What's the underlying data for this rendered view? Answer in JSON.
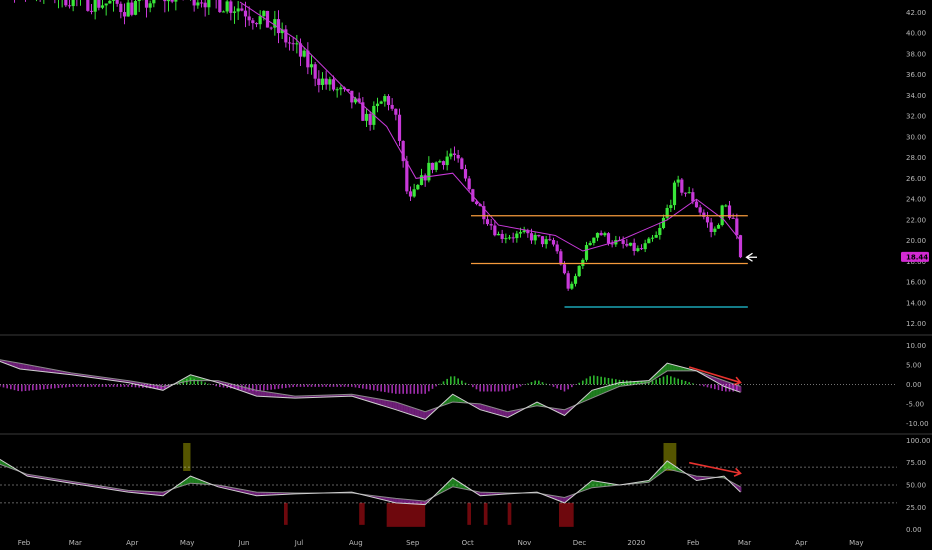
{
  "colors": {
    "bull": "#39e639",
    "bear": "#c839d9",
    "ma": "#c839d9",
    "channel": "#f59a3c",
    "support": "#21c7d9",
    "arrow_white": "#ffffff",
    "arrow_red": "#e8322e",
    "price_tag": "#d22ad2",
    "axis_text": "#b9b9b9",
    "separator": "#3a3a3a"
  },
  "chart_data": [
    {
      "type": "candlestick",
      "name": "price",
      "x_labels": [
        "Feb",
        "Mar",
        "Apr",
        "May",
        "Jun",
        "Jul",
        "Aug",
        "Sep",
        "Oct",
        "Nov",
        "Dec",
        "2020",
        "Feb",
        "Mar",
        "Apr",
        "May"
      ],
      "ylim": [
        11.0,
        43.2
      ],
      "yticks": [
        "12.00",
        "14.00",
        "16.00",
        "18.00",
        "20.00",
        "22.00",
        "24.00",
        "26.00",
        "28.00",
        "30.00",
        "32.00",
        "34.00",
        "36.00",
        "38.00",
        "40.00",
        "42.00"
      ],
      "last_price": "18.44",
      "close_path": [
        [
          "Jan 01",
          45.0
        ],
        [
          "Feb 01",
          44.5
        ],
        [
          "Mar 01",
          43.5
        ],
        [
          "Apr 01",
          42.5
        ],
        [
          "May 01",
          44.0
        ],
        [
          "Jun 01",
          42.5
        ],
        [
          "Jun 20",
          40.5
        ],
        [
          "Jul 01",
          38.5
        ],
        [
          "Jul 15",
          35.5
        ],
        [
          "Aug 01",
          33.5
        ],
        [
          "Aug 10",
          31.5
        ],
        [
          "Aug 20",
          34.0
        ],
        [
          "Aug 26",
          31.0
        ],
        [
          "Sep 01",
          23.5
        ],
        [
          "Sep 12",
          27.0
        ],
        [
          "Sep 25",
          28.5
        ],
        [
          "Oct 05",
          24.5
        ],
        [
          "Oct 20",
          20.5
        ],
        [
          "Nov 05",
          20.5
        ],
        [
          "Nov 20",
          19.5
        ],
        [
          "Nov 28",
          15.0
        ],
        [
          "Dec 05",
          18.5
        ],
        [
          "Dec 12",
          21.0
        ],
        [
          "Dec 20",
          20.0
        ],
        [
          "Jan 05",
          19.0
        ],
        [
          "Jan 15",
          20.5
        ],
        [
          "Jan 25",
          25.5
        ],
        [
          "Feb 03",
          24.0
        ],
        [
          "Feb 10",
          22.0
        ],
        [
          "Feb 14",
          20.5
        ],
        [
          "Feb 20",
          23.5
        ],
        [
          "Feb 25",
          22.0
        ],
        [
          "Feb 29",
          18.4
        ]
      ],
      "moving_average": [
        [
          "Jun 01",
          43.0
        ],
        [
          "Jul 01",
          39.5
        ],
        [
          "Aug 01",
          34.0
        ],
        [
          "Aug 20",
          31.0
        ],
        [
          "Sep 05",
          26.0
        ],
        [
          "Sep 25",
          26.5
        ],
        [
          "Oct 20",
          21.5
        ],
        [
          "Nov 20",
          20.5
        ],
        [
          "Dec 05",
          19.0
        ],
        [
          "Dec 25",
          20.0
        ],
        [
          "Jan 20",
          22.0
        ],
        [
          "Feb 05",
          24.0
        ],
        [
          "Feb 20",
          22.0
        ],
        [
          "Feb 29",
          20.0
        ]
      ],
      "lines": {
        "channel_top": {
          "from": "Oct 05",
          "to": "Mar 05",
          "value": 22.4
        },
        "channel_bottom": {
          "from": "Oct 05",
          "to": "Mar 05",
          "value": 17.8
        },
        "support": {
          "from": "Nov 25",
          "to": "Mar 05",
          "value": 13.6
        },
        "arrow": {
          "from": "Mar 10",
          "to": "Feb 29",
          "value": 18.4
        }
      }
    },
    {
      "type": "oscillator",
      "name": "macd",
      "ylim": [
        -12.5,
        12.5
      ],
      "yticks": [
        "10.00",
        "5.00",
        "0.00",
        "-5.00",
        "-10.00"
      ],
      "fast": [
        [
          "Jan 01",
          9.5
        ],
        [
          "Feb 01",
          4.0
        ],
        [
          "Mar 01",
          2.5
        ],
        [
          "Apr 01",
          0.5
        ],
        [
          "Apr 20",
          -1.5
        ],
        [
          "May 05",
          2.5
        ],
        [
          "May 20",
          0.5
        ],
        [
          "Jun 10",
          -3.0
        ],
        [
          "Jul 01",
          -3.5
        ],
        [
          "Aug 01",
          -3.0
        ],
        [
          "Aug 25",
          -6.5
        ],
        [
          "Sep 10",
          -9.0
        ],
        [
          "Sep 25",
          -2.5
        ],
        [
          "Oct 10",
          -6.5
        ],
        [
          "Oct 25",
          -8.5
        ],
        [
          "Nov 10",
          -4.5
        ],
        [
          "Nov 25",
          -8.0
        ],
        [
          "Dec 10",
          -1.5
        ],
        [
          "Dec 25",
          0.5
        ],
        [
          "Jan 10",
          1.0
        ],
        [
          "Jan 20",
          5.5
        ],
        [
          "Feb 05",
          3.5
        ],
        [
          "Feb 20",
          -0.5
        ],
        [
          "Feb 29",
          -2.0
        ]
      ],
      "slow": [
        [
          "Jan 01",
          8.0
        ],
        [
          "Feb 01",
          5.5
        ],
        [
          "Mar 01",
          3.0
        ],
        [
          "Apr 01",
          1.0
        ],
        [
          "Apr 20",
          -0.5
        ],
        [
          "May 05",
          1.0
        ],
        [
          "May 20",
          1.0
        ],
        [
          "Jun 10",
          -1.5
        ],
        [
          "Jul 01",
          -3.0
        ],
        [
          "Aug 01",
          -2.5
        ],
        [
          "Aug 25",
          -4.5
        ],
        [
          "Sep 10",
          -7.0
        ],
        [
          "Sep 25",
          -4.5
        ],
        [
          "Oct 10",
          -5.0
        ],
        [
          "Oct 25",
          -7.0
        ],
        [
          "Nov 10",
          -5.5
        ],
        [
          "Nov 25",
          -6.5
        ],
        [
          "Dec 10",
          -3.5
        ],
        [
          "Dec 25",
          -0.5
        ],
        [
          "Jan 10",
          0.5
        ],
        [
          "Jan 20",
          3.5
        ],
        [
          "Feb 05",
          3.5
        ],
        [
          "Feb 20",
          1.0
        ],
        [
          "Feb 29",
          -0.5
        ]
      ],
      "arrow": {
        "from": [
          "Feb 01",
          4.5
        ],
        "to": [
          "Mar 01",
          0.5
        ]
      }
    },
    {
      "type": "oscillator",
      "name": "rsi",
      "ylim": [
        -6,
        106
      ],
      "yticks": [
        "100.00",
        "75.00",
        "50.00",
        "25.00",
        "0.00"
      ],
      "levels": [
        70,
        50,
        30
      ],
      "fast": [
        [
          "Jan 01",
          78
        ],
        [
          "Jan 20",
          80
        ],
        [
          "Feb 05",
          60
        ],
        [
          "Mar 01",
          52
        ],
        [
          "Apr 01",
          42
        ],
        [
          "Apr 20",
          38
        ],
        [
          "May 05",
          60
        ],
        [
          "May 20",
          48
        ],
        [
          "Jun 10",
          38
        ],
        [
          "Jul 01",
          40
        ],
        [
          "Aug 01",
          42
        ],
        [
          "Aug 25",
          30
        ],
        [
          "Sep 10",
          28
        ],
        [
          "Sep 25",
          58
        ],
        [
          "Oct 10",
          38
        ],
        [
          "Oct 25",
          40
        ],
        [
          "Nov 10",
          42
        ],
        [
          "Nov 25",
          30
        ],
        [
          "Dec 10",
          55
        ],
        [
          "Dec 25",
          50
        ],
        [
          "Jan 10",
          55
        ],
        [
          "Jan 20",
          77
        ],
        [
          "Feb 05",
          55
        ],
        [
          "Feb 20",
          60
        ],
        [
          "Feb 29",
          42
        ]
      ],
      "slow": [
        [
          "Jan 01",
          72
        ],
        [
          "Jan 20",
          74
        ],
        [
          "Feb 05",
          62
        ],
        [
          "Mar 01",
          54
        ],
        [
          "Apr 01",
          44
        ],
        [
          "Apr 20",
          42
        ],
        [
          "May 05",
          52
        ],
        [
          "May 20",
          50
        ],
        [
          "Jun 10",
          42
        ],
        [
          "Jul 01",
          41
        ],
        [
          "Aug 01",
          41
        ],
        [
          "Aug 25",
          35
        ],
        [
          "Sep 10",
          32
        ],
        [
          "Sep 25",
          48
        ],
        [
          "Oct 10",
          42
        ],
        [
          "Oct 25",
          41
        ],
        [
          "Nov 10",
          41
        ],
        [
          "Nov 25",
          36
        ],
        [
          "Dec 10",
          47
        ],
        [
          "Dec 25",
          50
        ],
        [
          "Jan 10",
          53
        ],
        [
          "Jan 20",
          68
        ],
        [
          "Feb 05",
          60
        ],
        [
          "Feb 20",
          58
        ],
        [
          "Feb 29",
          48
        ]
      ],
      "arrow": {
        "from": [
          "Feb 01",
          75
        ],
        "to": [
          "Mar 01",
          63
        ]
      },
      "zones_overbought": [
        [
          "Jan 01",
          "Jan 20"
        ],
        [
          "May 01",
          "May 05"
        ],
        [
          "Jan 18",
          "Jan 25"
        ]
      ],
      "zones_oversold": [
        [
          "Aug 20",
          "Sep 10"
        ],
        [
          "Nov 22",
          "Nov 30"
        ]
      ]
    }
  ]
}
